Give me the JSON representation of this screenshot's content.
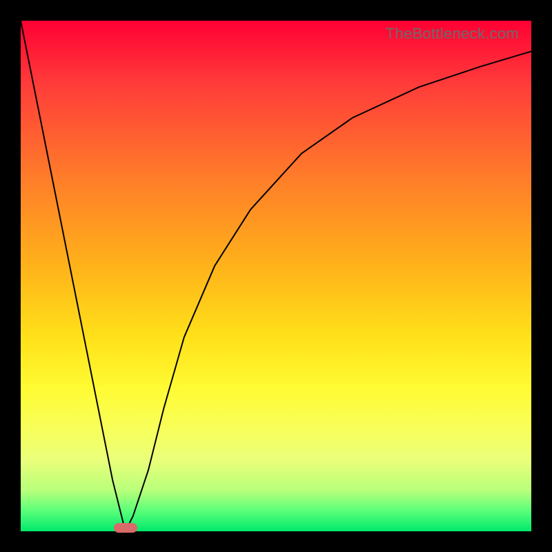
{
  "watermark": "TheBottleneck.com",
  "chart_data": {
    "type": "line",
    "title": "",
    "xlabel": "",
    "ylabel": "",
    "xlim": [
      0,
      100
    ],
    "ylim": [
      0,
      100
    ],
    "grid": false,
    "legend": false,
    "background_gradient": {
      "direction": "vertical",
      "stops": [
        {
          "pos": 0.0,
          "color": "#ff0033"
        },
        {
          "pos": 0.5,
          "color": "#ffb21a"
        },
        {
          "pos": 0.75,
          "color": "#fffb33"
        },
        {
          "pos": 1.0,
          "color": "#00e86b"
        }
      ]
    },
    "series": [
      {
        "name": "bottleneck-curve",
        "color": "#000000",
        "x": [
          0,
          5,
          10,
          15,
          18,
          20,
          20.5,
          22,
          25,
          28,
          32,
          38,
          45,
          55,
          65,
          78,
          90,
          100
        ],
        "values": [
          100,
          75,
          50,
          25,
          10,
          2,
          0,
          3,
          12,
          24,
          38,
          52,
          63,
          74,
          81,
          87,
          91,
          94
        ]
      }
    ],
    "annotations": [
      {
        "type": "marker",
        "name": "optimal-marker",
        "x": 20.5,
        "y": 0,
        "color": "#d96a6a"
      }
    ]
  }
}
